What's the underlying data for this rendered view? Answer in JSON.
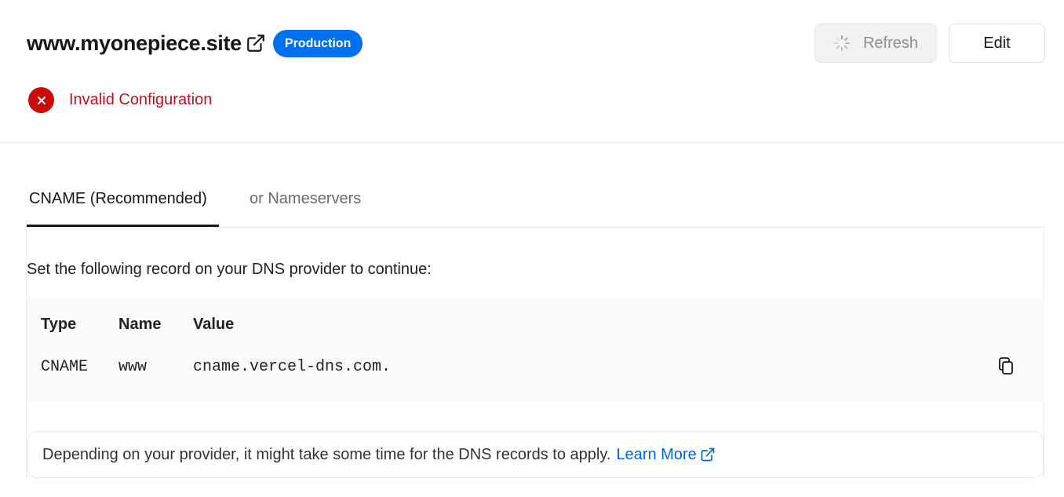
{
  "domain": {
    "name": "www.myonepiece.site",
    "badge": "Production",
    "status": "Invalid Configuration"
  },
  "actions": {
    "refresh_label": "Refresh",
    "edit_label": "Edit"
  },
  "tabs": [
    {
      "label": "CNAME (Recommended)",
      "active": true
    },
    {
      "label": "or Nameservers",
      "active": false
    }
  ],
  "instructions": "Set the following record on your DNS provider to continue:",
  "record": {
    "headers": {
      "type": "Type",
      "name": "Name",
      "value": "Value"
    },
    "type": "CNAME",
    "name": "www",
    "value": "cname.vercel-dns.com."
  },
  "note": {
    "text": "Depending on your provider, it might take some time for the DNS records to apply.",
    "link": "Learn More"
  },
  "colors": {
    "accent": "#0070f3",
    "error": "#cb0a0a",
    "link": "#0068d6"
  }
}
